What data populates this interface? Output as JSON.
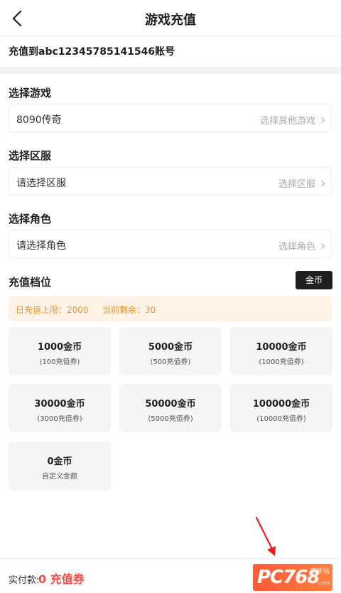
{
  "header": {
    "title": "游戏充值",
    "back_icon": "back-arrow-icon"
  },
  "account": {
    "text": "充值到abc12345785141546账号"
  },
  "game": {
    "label": "选择游戏",
    "value": "8090传奇",
    "action": "选择其他游戏"
  },
  "server": {
    "label": "选择区服",
    "value": "请选择区服",
    "action": "选择区服"
  },
  "role": {
    "label": "选择角色",
    "value": "请选择角色",
    "action": "选择角色"
  },
  "tiers": {
    "label": "充值档位",
    "currency_button": "金币",
    "limit_text": "日充值上限：2000",
    "remaining_text": "当前剩余：30",
    "items": [
      {
        "amount": "1000金币",
        "note": "(100充值券)"
      },
      {
        "amount": "5000金币",
        "note": "(500充值券)"
      },
      {
        "amount": "10000金币",
        "note": "(1000充值券)"
      },
      {
        "amount": "30000金币",
        "note": "(3000充值券)"
      },
      {
        "amount": "50000金币",
        "note": "(5000充值券)"
      },
      {
        "amount": "100000金币",
        "note": "(10000充值券)"
      },
      {
        "amount": "0金币",
        "note": "自定义金额"
      }
    ]
  },
  "footer": {
    "pay_label": "实付款:",
    "pay_amount": "0 充值券",
    "watermark_main": "PC768",
    "watermark_sub": "软件站",
    "watermark_domain": ".com"
  },
  "colors": {
    "accent": "#ff4a3d",
    "limit_text": "#e8952e",
    "limit_bg": "#fff3e7",
    "dark_button": "#1f1f1f"
  }
}
